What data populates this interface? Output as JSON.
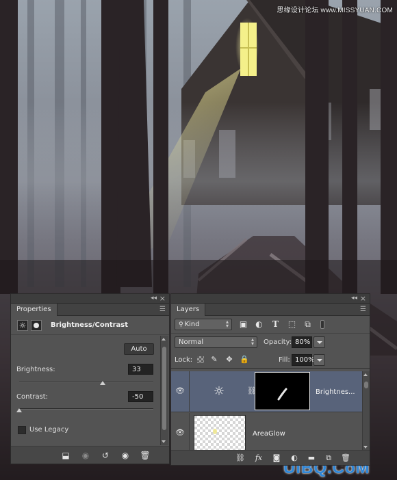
{
  "watermark": {
    "top": "思缘设计论坛 www.MISSYUAN.COM",
    "bottom": "UiBQ.CoM"
  },
  "properties": {
    "tab_label": "Properties",
    "icons": {
      "adjustment": "brightness-contrast-icon",
      "mask": "layer-mask-icon"
    },
    "adjustment_title": "Brightness/Contrast",
    "auto_label": "Auto",
    "brightness": {
      "label": "Brightness:",
      "value": "33",
      "slider_fraction": 0.62
    },
    "contrast": {
      "label": "Contrast:",
      "value": "-50",
      "slider_fraction": 0.0
    },
    "use_legacy": {
      "label": "Use Legacy",
      "checked": false
    },
    "footer_icons": [
      "clip-to-layer-icon",
      "view-previous-state-icon",
      "reset-icon",
      "toggle-visibility-icon",
      "delete-icon"
    ]
  },
  "layers": {
    "tab_label": "Layers",
    "filter": {
      "kind_label": "Kind"
    },
    "filter_icons": [
      "pixel-layer-filter-icon",
      "adjustment-layer-filter-icon",
      "type-layer-filter-icon",
      "shape-layer-filter-icon",
      "smart-object-filter-icon"
    ],
    "blend_mode": "Normal",
    "opacity": {
      "label": "Opacity:",
      "value": "80%"
    },
    "lock": {
      "label": "Lock:"
    },
    "fill": {
      "label": "Fill:",
      "value": "100%"
    },
    "rows": [
      {
        "name": "Brightnes...",
        "type": "adjustment",
        "visible": true,
        "selected": true
      },
      {
        "name": "AreaGlow",
        "type": "pixel",
        "visible": true,
        "selected": false
      }
    ],
    "footer_icons": [
      "link-layers-icon",
      "fx-icon",
      "add-mask-icon",
      "adjustment-layer-icon",
      "folder-icon",
      "new-layer-icon",
      "delete-icon"
    ]
  },
  "colors": {
    "panel_bg": "#535353",
    "selected_row": "#58637a",
    "window_glow": "#f4f08a"
  }
}
